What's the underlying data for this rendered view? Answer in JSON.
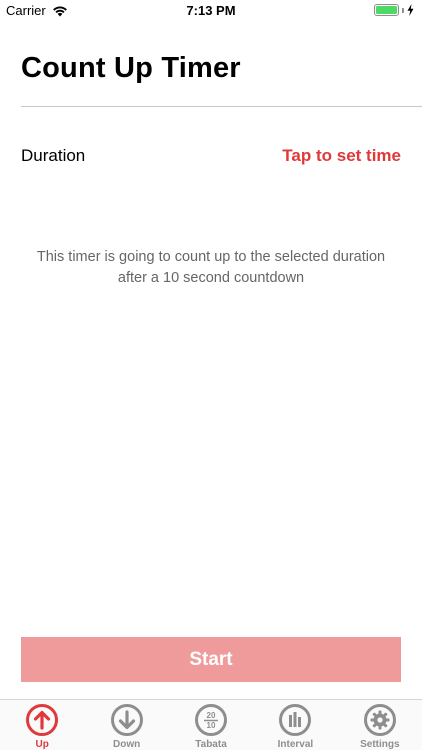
{
  "status_bar": {
    "carrier": "Carrier",
    "time": "7:13 PM",
    "battery_level": 1.0
  },
  "header": {
    "title": "Count Up Timer"
  },
  "duration": {
    "label": "Duration",
    "action": "Tap to set time"
  },
  "description": "This timer is going to count up to the selected duration after a 10 second countdown",
  "start_button": {
    "label": "Start"
  },
  "tabs": [
    {
      "label": "Up",
      "icon": "arrow-up-circle-icon",
      "active": true
    },
    {
      "label": "Down",
      "icon": "arrow-down-circle-icon",
      "active": false
    },
    {
      "label": "Tabata",
      "icon": "tabata-20-10-icon",
      "active": false,
      "icon_text_top": "20",
      "icon_text_bottom": "10"
    },
    {
      "label": "Interval",
      "icon": "interval-bars-icon",
      "active": false
    },
    {
      "label": "Settings",
      "icon": "gear-icon",
      "active": false
    }
  ],
  "colors": {
    "accent": "#e0393b",
    "start_button": "#f09b9b",
    "inactive": "#8e8e8e"
  }
}
